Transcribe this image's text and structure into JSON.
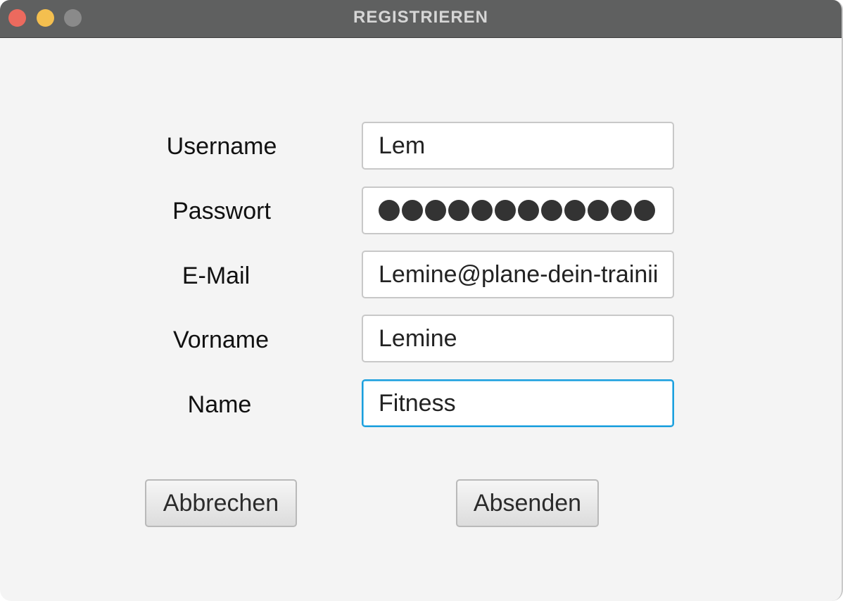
{
  "window": {
    "title": "REGISTRIEREN"
  },
  "form": {
    "username": {
      "label": "Username",
      "value": "Lem"
    },
    "password": {
      "label": "Passwort",
      "masked_count": 12
    },
    "email": {
      "label": "E-Mail",
      "value": "Lemine@plane-dein-trainii"
    },
    "firstname": {
      "label": "Vorname",
      "value": "Lemine"
    },
    "name": {
      "label": "Name",
      "value": "Fitness"
    }
  },
  "buttons": {
    "cancel_label": "Abbrechen",
    "submit_label": "Absenden"
  },
  "colors": {
    "titlebar": "#5f6060",
    "window_bg": "#f4f4f4",
    "focus_ring": "#1a9fdd",
    "close": "#ec6a5e",
    "minimize": "#f4bf4f",
    "maximize": "#8a8a8a"
  }
}
